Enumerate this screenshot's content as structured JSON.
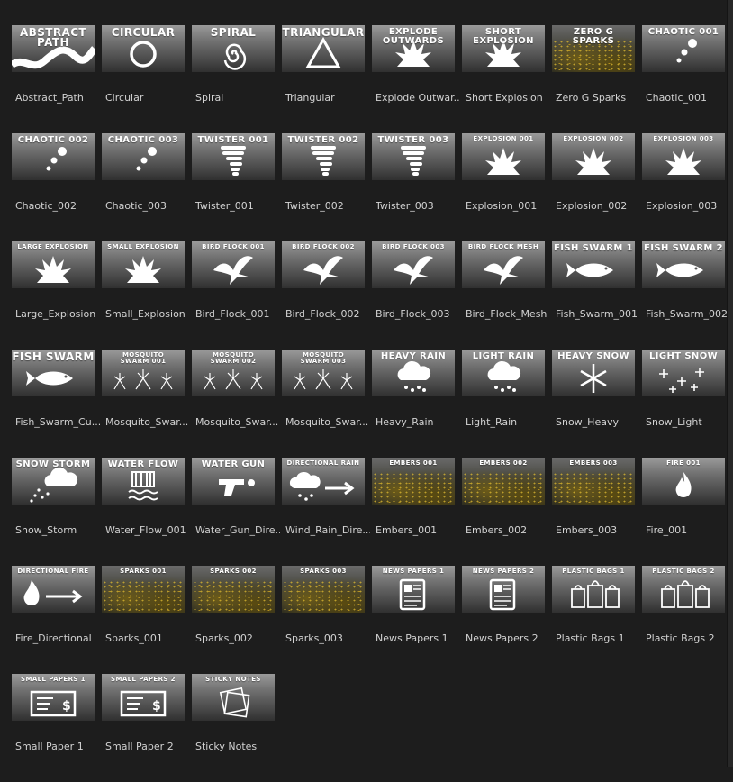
{
  "assets": [
    {
      "label": "Abstract_Path",
      "title": "ABSTRACT\nPATH",
      "size": "lg",
      "icon": "wave-path-icon"
    },
    {
      "label": "Circular",
      "title": "CIRCULAR",
      "size": "lg",
      "icon": "circle-icon"
    },
    {
      "label": "Spiral",
      "title": "SPIRAL",
      "size": "lg",
      "icon": "spiral-icon"
    },
    {
      "label": "Triangular",
      "title": "TRIANGULAR",
      "size": "lg",
      "icon": "triangle-icon"
    },
    {
      "label": "Explode Outwar...",
      "title": "EXPLODE\nOUTWARDS",
      "size": "md",
      "icon": "explosion-icon"
    },
    {
      "label": "Short Explosion",
      "title": "SHORT\nEXPLOSION",
      "size": "md",
      "icon": "explosion-icon"
    },
    {
      "label": "Zero G Sparks",
      "title": "ZERO G SPARKS",
      "size": "md",
      "icon": "sparks-icon"
    },
    {
      "label": "Chaotic_001",
      "title": "CHAOTIC 001",
      "size": "md",
      "icon": "dots-icon"
    },
    {
      "label": "Chaotic_002",
      "title": "CHAOTIC 002",
      "size": "md",
      "icon": "dots-icon"
    },
    {
      "label": "Chaotic_003",
      "title": "CHAOTIC 003",
      "size": "md",
      "icon": "dots-icon"
    },
    {
      "label": "Twister_001",
      "title": "TWISTER 001",
      "size": "md",
      "icon": "tornado-icon"
    },
    {
      "label": "Twister_002",
      "title": "TWISTER 002",
      "size": "md",
      "icon": "tornado-icon"
    },
    {
      "label": "Twister_003",
      "title": "TWISTER 003",
      "size": "md",
      "icon": "tornado-icon"
    },
    {
      "label": "Explosion_001",
      "title": "EXPLOSION 001",
      "size": "sm",
      "icon": "explosion-icon"
    },
    {
      "label": "Explosion_002",
      "title": "EXPLOSION 002",
      "size": "sm",
      "icon": "explosion-icon"
    },
    {
      "label": "Explosion_003",
      "title": "EXPLOSION 003",
      "size": "sm",
      "icon": "explosion-icon"
    },
    {
      "label": "Large_Explosion",
      "title": "LARGE EXPLOSION",
      "size": "sm",
      "icon": "explosion-icon"
    },
    {
      "label": "Small_Explosion",
      "title": "SMALL EXPLOSION",
      "size": "sm",
      "icon": "explosion-icon"
    },
    {
      "label": "Bird_Flock_001",
      "title": "BIRD FLOCK 001",
      "size": "sm",
      "icon": "bird-icon"
    },
    {
      "label": "Bird_Flock_002",
      "title": "BIRD FLOCK 002",
      "size": "sm",
      "icon": "bird-icon"
    },
    {
      "label": "Bird_Flock_003",
      "title": "BIRD FLOCK 003",
      "size": "sm",
      "icon": "bird-icon"
    },
    {
      "label": "Bird_Flock_Mesh",
      "title": "BIRD FLOCK MESH",
      "size": "sm",
      "icon": "bird-icon"
    },
    {
      "label": "Fish_Swarm_001",
      "title": "FISH SWARM 1",
      "size": "md",
      "icon": "fish-icon"
    },
    {
      "label": "Fish_Swarm_002",
      "title": "FISH SWARM 2",
      "size": "md",
      "icon": "fish-icon"
    },
    {
      "label": "Fish_Swarm_Cu...",
      "title": "FISH SWARM",
      "size": "lg",
      "icon": "fish-icon"
    },
    {
      "label": "Mosquito_Swar...",
      "title": "MOSQUITO\nSWARM 001",
      "size": "sm",
      "icon": "mosquito-icon"
    },
    {
      "label": "Mosquito_Swar...",
      "title": "MOSQUITO\nSWARM 002",
      "size": "sm",
      "icon": "mosquito-icon"
    },
    {
      "label": "Mosquito_Swar...",
      "title": "MOSQUITO\nSWARM 003",
      "size": "sm",
      "icon": "mosquito-icon"
    },
    {
      "label": "Heavy_Rain",
      "title": "HEAVY RAIN",
      "size": "md",
      "icon": "rain-cloud-icon"
    },
    {
      "label": "Light_Rain",
      "title": "LIGHT RAIN",
      "size": "md",
      "icon": "rain-cloud-icon"
    },
    {
      "label": "Snow_Heavy",
      "title": "HEAVY SNOW",
      "size": "md",
      "icon": "snowflake-icon"
    },
    {
      "label": "Snow_Light",
      "title": "LIGHT SNOW",
      "size": "md",
      "icon": "snowflakes-icon"
    },
    {
      "label": "Snow_Storm",
      "title": "SNOW STORM",
      "size": "md",
      "icon": "snow-cloud-icon"
    },
    {
      "label": "Water_Flow_001",
      "title": "WATER FLOW",
      "size": "md",
      "icon": "water-flow-icon"
    },
    {
      "label": "Water_Gun_Dire...",
      "title": "WATER GUN",
      "size": "md",
      "icon": "water-gun-icon"
    },
    {
      "label": "Wind_Rain_Dire...",
      "title": "DIRECTIONAL RAIN",
      "size": "sm",
      "icon": "rain-arrow-icon"
    },
    {
      "label": "Embers_001",
      "title": "EMBERS 001",
      "size": "sm",
      "icon": "sparks-icon"
    },
    {
      "label": "Embers_002",
      "title": "EMBERS 002",
      "size": "sm",
      "icon": "sparks-icon"
    },
    {
      "label": "Embers_003",
      "title": "EMBERS 003",
      "size": "sm",
      "icon": "sparks-icon"
    },
    {
      "label": "Fire_001",
      "title": "FIRE 001",
      "size": "sm",
      "icon": "flame-icon"
    },
    {
      "label": "Fire_Directional",
      "title": "DIRECTIONAL FIRE",
      "size": "sm",
      "icon": "flame-arrow-icon"
    },
    {
      "label": "Sparks_001",
      "title": "SPARKS 001",
      "size": "sm",
      "icon": "sparks-icon"
    },
    {
      "label": "Sparks_002",
      "title": "SPARKS 002",
      "size": "sm",
      "icon": "sparks-icon"
    },
    {
      "label": "Sparks_003",
      "title": "SPARKS 003",
      "size": "sm",
      "icon": "sparks-icon"
    },
    {
      "label": "News Papers 1",
      "title": "NEWS PAPERS 1",
      "size": "sm",
      "icon": "newspaper-icon"
    },
    {
      "label": "News Papers 2",
      "title": "NEWS PAPERS 2",
      "size": "sm",
      "icon": "newspaper-icon"
    },
    {
      "label": "Plastic Bags 1",
      "title": "PLASTIC BAGS 1",
      "size": "sm",
      "icon": "plastic-bag-icon"
    },
    {
      "label": "Plastic Bags 2",
      "title": "PLASTIC BAGS 2",
      "size": "sm",
      "icon": "plastic-bag-icon"
    },
    {
      "label": "Small Paper 1",
      "title": "SMALL PAPERS 1",
      "size": "sm",
      "icon": "bill-icon"
    },
    {
      "label": "Small Paper 2",
      "title": "SMALL PAPERS 2",
      "size": "sm",
      "icon": "bill-icon"
    },
    {
      "label": "Sticky Notes",
      "title": "STICKY NOTES",
      "size": "sm",
      "icon": "sticky-notes-icon"
    }
  ]
}
